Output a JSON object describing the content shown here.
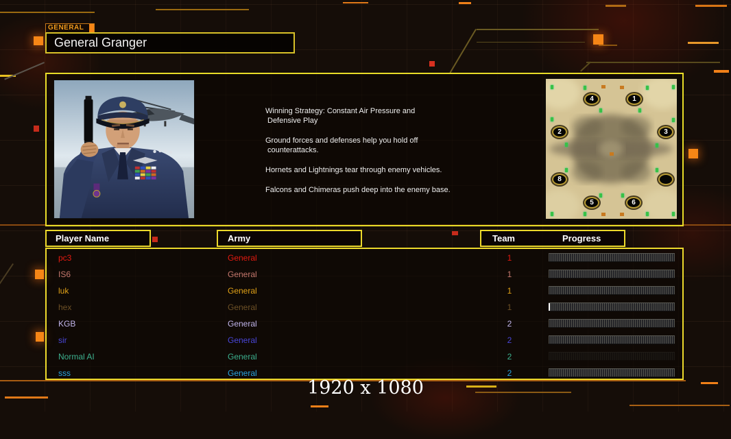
{
  "header": {
    "faction_tag": "GENERAL",
    "general_name": "General Granger"
  },
  "briefing": {
    "paragraphs": [
      [
        "Winning Strategy: Constant Air Pressure and",
        "Defensive Play"
      ],
      [
        "Ground forces and defenses help you hold off",
        "counterattacks."
      ],
      [
        "Hornets and Lightnings tear through enemy vehicles."
      ],
      [
        "Falcons and Chimeras push deep into the enemy base."
      ]
    ]
  },
  "map": {
    "positions": [
      "4",
      "1",
      "2",
      "3",
      "8",
      "",
      "5",
      "6"
    ]
  },
  "table": {
    "headers": {
      "player": "Player Name",
      "army": "Army",
      "team": "Team",
      "progress": "Progress"
    },
    "rows": [
      {
        "name": "pc3",
        "army": "General",
        "team": "1",
        "color": "#e41a10",
        "bar": "empty"
      },
      {
        "name": "IS6",
        "army": "General",
        "team": "1",
        "color": "#c5786d",
        "bar": "empty"
      },
      {
        "name": "luk",
        "army": "General",
        "team": "1",
        "color": "#e2a217",
        "bar": "empty"
      },
      {
        "name": "hex",
        "army": "General",
        "team": "1",
        "color": "#6e5126",
        "bar": "starting"
      },
      {
        "name": "KGB",
        "army": "General",
        "team": "2",
        "color": "#c0b4ea",
        "bar": "empty"
      },
      {
        "name": "sir",
        "army": "General",
        "team": "2",
        "color": "#4946d8",
        "bar": "empty"
      },
      {
        "name": "Normal AI",
        "army": "General",
        "team": "2",
        "color": "#3cb08e",
        "bar": "faint"
      },
      {
        "name": "sss",
        "army": "General",
        "team": "2",
        "color": "#2aa5e0",
        "bar": "empty"
      }
    ]
  },
  "overlay": {
    "resolution": "1920 x 1080"
  },
  "colors": {
    "accent_yellow": "#e8dc28",
    "accent_orange": "#f68616",
    "alert_red": "#c62b1b"
  }
}
